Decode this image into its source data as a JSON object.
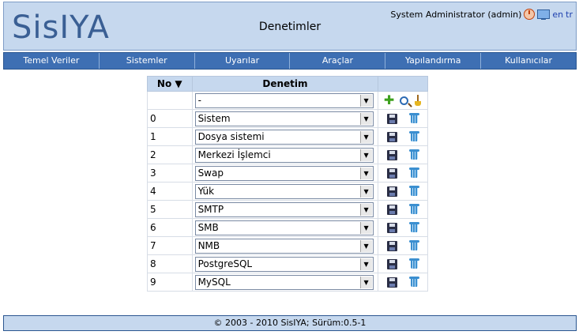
{
  "header": {
    "logo_text": "SisIYA",
    "title": "Denetimler",
    "user": "System Administrator (admin)",
    "lang_en": "en",
    "lang_tr": "tr"
  },
  "nav": [
    {
      "label": "Temel Veriler"
    },
    {
      "label": "Sistemler"
    },
    {
      "label": "Uyarılar"
    },
    {
      "label": "Araçlar"
    },
    {
      "label": "Yapılandırma"
    },
    {
      "label": "Kullanıcılar"
    }
  ],
  "table": {
    "header_no": "No ▼",
    "header_check": "Denetim",
    "new_row": {
      "select": "-"
    },
    "rows": [
      {
        "no": "0",
        "name": "Sistem"
      },
      {
        "no": "1",
        "name": "Dosya sistemi"
      },
      {
        "no": "2",
        "name": "Merkezi İşlemci"
      },
      {
        "no": "3",
        "name": "Swap"
      },
      {
        "no": "4",
        "name": "Yük"
      },
      {
        "no": "5",
        "name": "SMTP"
      },
      {
        "no": "6",
        "name": "SMB"
      },
      {
        "no": "7",
        "name": "NMB"
      },
      {
        "no": "8",
        "name": "PostgreSQL"
      },
      {
        "no": "9",
        "name": "MySQL"
      }
    ]
  },
  "footer": {
    "text": "© 2003 - 2010 SisIYA; Sürüm:0.5-1"
  }
}
